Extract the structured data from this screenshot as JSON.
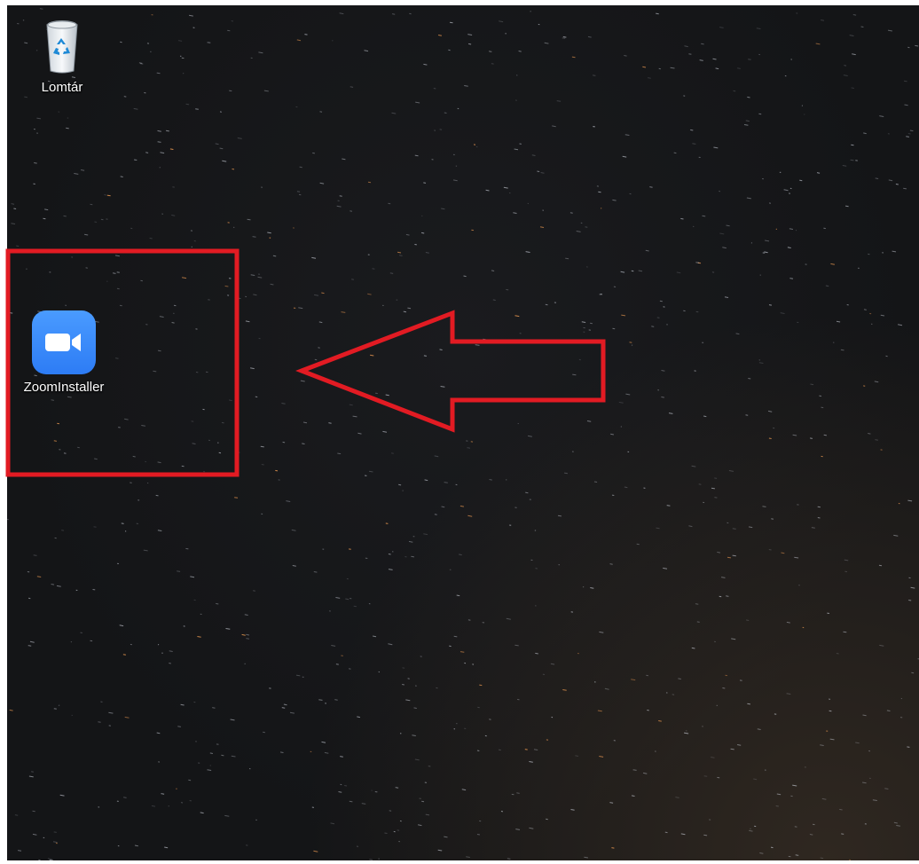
{
  "desktop": {
    "icons": [
      {
        "label": "Lomtár",
        "icon": "recycle-bin-icon"
      },
      {
        "label": "ZoomInstaller",
        "icon": "zoom-camera-icon"
      }
    ]
  },
  "annotation": {
    "color": "#e21b23",
    "shapes": [
      "highlight-rectangle",
      "left-arrow"
    ]
  }
}
